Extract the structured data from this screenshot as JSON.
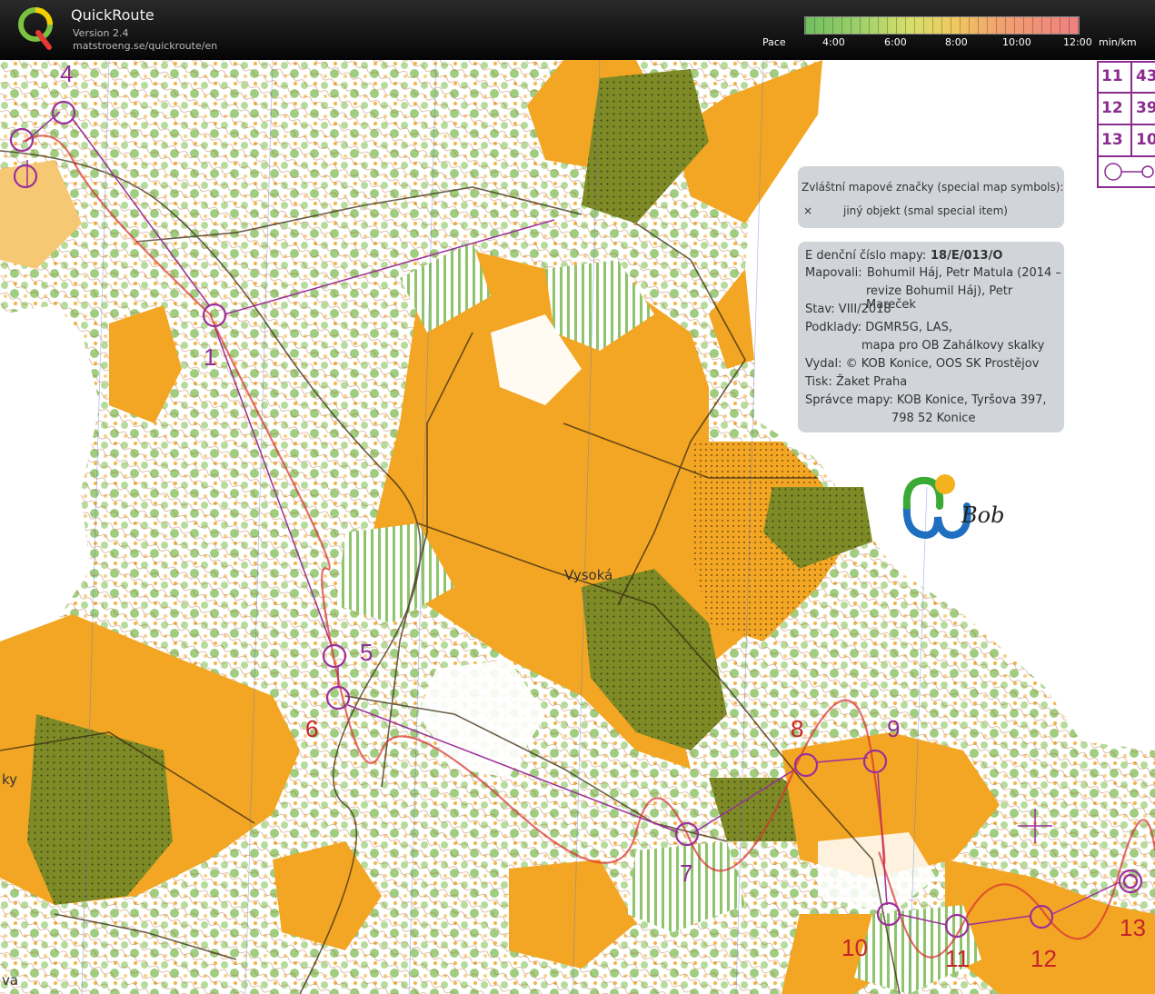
{
  "app": {
    "title": "QuickRoute",
    "version": "Version 2.4",
    "url": "matstroeng.se/quickroute/en"
  },
  "pace_scale": {
    "label": "Pace",
    "ticks": [
      "4:00",
      "6:00",
      "8:00",
      "10:00",
      "12:00"
    ],
    "unit": "min/km",
    "colors": [
      "#6fbf5f",
      "#d6df6a",
      "#f0c860",
      "#f2a070",
      "#ee8080"
    ]
  },
  "map": {
    "colors": {
      "open_yellow": "#f3a623",
      "forest_white": "#ffffff",
      "green": "#8fc46a",
      "olive": "#6b7a1e",
      "contour": "#b0602a",
      "course_purple": "#9b2f9b",
      "route_red": "#d93030"
    },
    "place_names": [
      "Vysoká",
      "ky",
      "va"
    ],
    "control_numbers": [
      "1",
      "4",
      "5",
      "6",
      "7",
      "8",
      "9",
      "10",
      "11",
      "12",
      "13"
    ]
  },
  "control_table": {
    "rows": [
      {
        "num": "11",
        "code": "43"
      },
      {
        "num": "12",
        "code": "39"
      },
      {
        "num": "13",
        "code": "10"
      }
    ]
  },
  "legend_special": {
    "title": "Zvláštní mapové značky (special map symbols):",
    "symbol": "×",
    "item": "jiný objekt (smal special item)"
  },
  "legend_info": {
    "line1_label": "E denční číslo mapy:",
    "line1_value": "18/E/013/O",
    "mapovali_label": "Mapovali:",
    "mapovali_value1": "Bohumil Háj, Petr Matula (2014 –",
    "mapovali_value2": "revize Bohumil Háj),  Petr Mareček",
    "stav": "Stav: VIII/2018",
    "podklady_label": "Podklady: DGMR5G, LAS,",
    "podklady_value2": "mapa pro OB Zahálkovy skalky",
    "vydal": "Vydal:  © KOB Konice, OOS SK Prostějov",
    "tisk": "Tisk:  Žaket Praha",
    "spravce": "Správce mapy:  KOB Konice, Tyršova 397,",
    "spravce2": "798 52 Konice"
  },
  "club_logo_text": "Bob"
}
